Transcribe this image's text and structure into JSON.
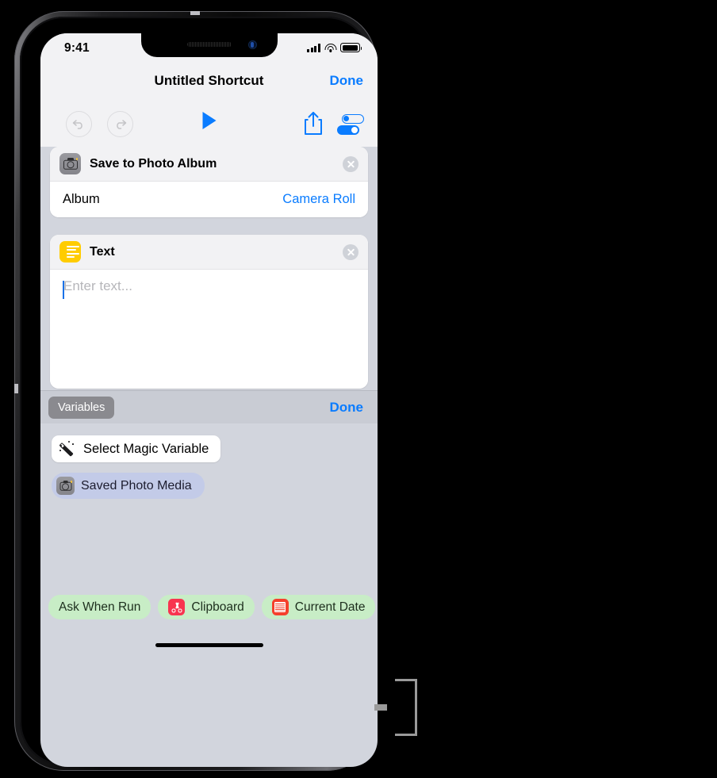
{
  "status_bar": {
    "time": "9:41",
    "cellular_icon": "signal-bars-icon",
    "wifi_icon": "wifi-icon",
    "battery_icon": "battery-icon"
  },
  "nav": {
    "title": "Untitled Shortcut",
    "done_label": "Done"
  },
  "toolbar": {
    "undo_icon": "undo-icon",
    "redo_icon": "redo-icon",
    "play_icon": "play-icon",
    "share_icon": "share-icon",
    "settings_icon": "settings-toggles-icon"
  },
  "actions": [
    {
      "title": "Save to Photo Album",
      "icon": "camera-icon",
      "icon_color": "#8e8e93",
      "remove_icon": "close-circle-icon",
      "param_label": "Album",
      "param_value": "Camera Roll"
    },
    {
      "title": "Text",
      "icon": "text-lines-icon",
      "icon_color": "#ffcc00",
      "remove_icon": "close-circle-icon",
      "text_value": "",
      "text_placeholder": "Enter text..."
    }
  ],
  "accessory_bar": {
    "variables_label": "Variables",
    "done_label": "Done"
  },
  "variables_panel": {
    "magic_variable_label": "Select Magic Variable",
    "magic_variable_icon": "magic-wand-icon",
    "items": [
      {
        "label": "Saved Photo Media",
        "icon": "camera-icon"
      }
    ]
  },
  "bottom_chips": [
    {
      "label": "Ask When Run",
      "icon": null
    },
    {
      "label": "Clipboard",
      "icon": "scissors-icon",
      "icon_color": "#f8344f"
    },
    {
      "label": "Current Date",
      "icon": "calendar-icon",
      "icon_color": "#f5402c"
    }
  ],
  "colors": {
    "accent_blue": "#0a7cff",
    "chip_green": "#c8edc6",
    "panel_gray": "#d2d5dd",
    "bar_gray": "#c9ccd4"
  }
}
